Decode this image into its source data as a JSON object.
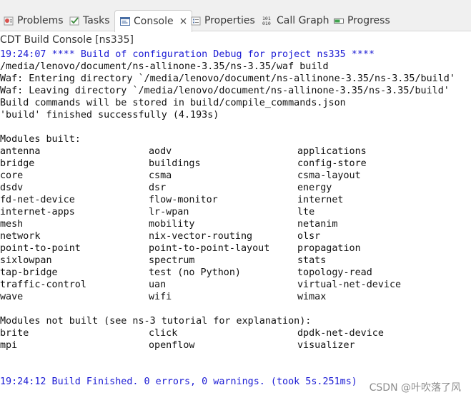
{
  "tabs": [
    {
      "label": "Problems",
      "icon": "problems-icon"
    },
    {
      "label": "Tasks",
      "icon": "tasks-icon"
    },
    {
      "label": "Console",
      "icon": "console-icon",
      "active": true
    },
    {
      "label": "Properties",
      "icon": "properties-icon"
    },
    {
      "label": "Call Graph",
      "icon": "call-graph-icon"
    },
    {
      "label": "Progress",
      "icon": "progress-icon"
    }
  ],
  "close_glyph": "×",
  "console_title": "CDT Build Console [ns335]",
  "header_lines": [
    {
      "text": "19:24:07 **** Build of configuration Debug for project ns335 ****",
      "color": "#1b1bd4"
    },
    {
      "text": "/media/lenovo/document/ns-allinone-3.35/ns-3.35/waf build",
      "color": "#111111"
    },
    {
      "text": "Waf: Entering directory `/media/lenovo/document/ns-allinone-3.35/ns-3.35/build'",
      "color": "#111111"
    },
    {
      "text": "Waf: Leaving directory `/media/lenovo/document/ns-allinone-3.35/ns-3.35/build'",
      "color": "#111111"
    },
    {
      "text": "Build commands will be stored in build/compile_commands.json",
      "color": "#111111"
    },
    {
      "text": "'build' finished successfully (4.193s)",
      "color": "#111111"
    }
  ],
  "modules_built_heading": "Modules built:",
  "modules_built": [
    [
      "antenna",
      "aodv",
      "applications"
    ],
    [
      "bridge",
      "buildings",
      "config-store"
    ],
    [
      "core",
      "csma",
      "csma-layout"
    ],
    [
      "dsdv",
      "dsr",
      "energy"
    ],
    [
      "fd-net-device",
      "flow-monitor",
      "internet"
    ],
    [
      "internet-apps",
      "lr-wpan",
      "lte"
    ],
    [
      "mesh",
      "mobility",
      "netanim"
    ],
    [
      "network",
      "nix-vector-routing",
      "olsr"
    ],
    [
      "point-to-point",
      "point-to-point-layout",
      "propagation"
    ],
    [
      "sixlowpan",
      "spectrum",
      "stats"
    ],
    [
      "tap-bridge",
      "test (no Python)",
      "topology-read"
    ],
    [
      "traffic-control",
      "uan",
      "virtual-net-device"
    ],
    [
      "wave",
      "wifi",
      "wimax"
    ]
  ],
  "modules_not_built_heading": "Modules not built (see ns-3 tutorial for explanation):",
  "modules_not_built": [
    [
      "brite",
      "click",
      "dpdk-net-device"
    ],
    [
      "mpi",
      "openflow",
      "visualizer"
    ]
  ],
  "finish_line": "19:24:12 Build Finished. 0 errors, 0 warnings. (took 5s.251ms)",
  "finish_color": "#1b1bd4",
  "watermark": "CSDN @叶吹落了风"
}
